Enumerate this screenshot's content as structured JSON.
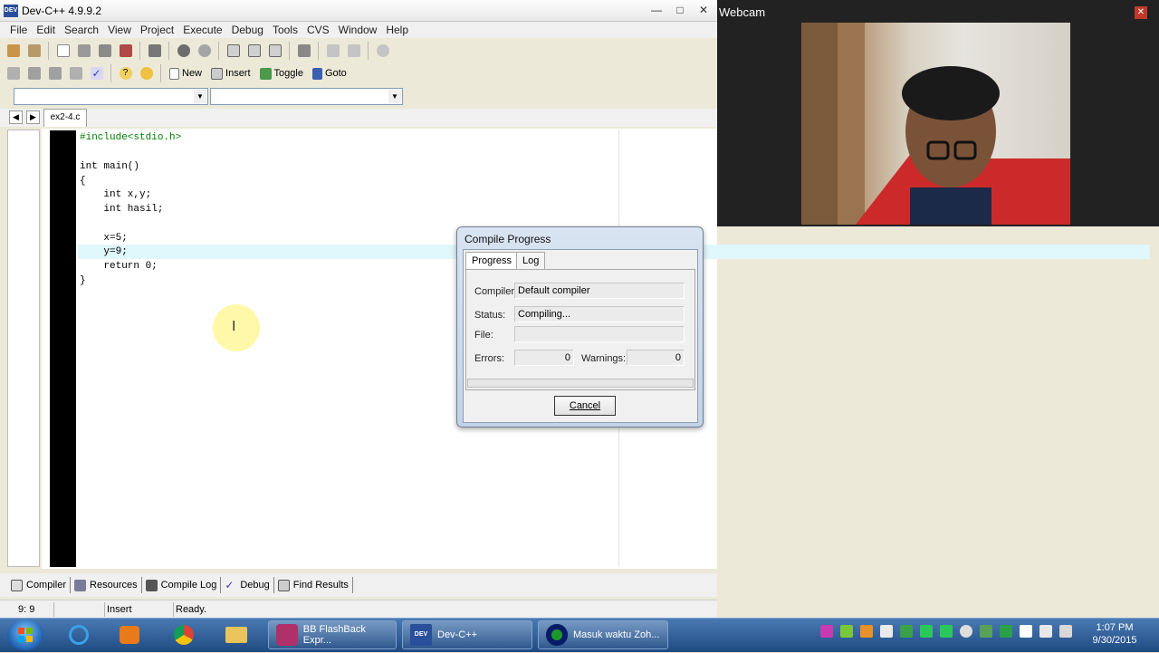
{
  "window": {
    "title": "Dev-C++ 4.9.9.2",
    "minimize": "—",
    "maximize": "□",
    "close": "✕"
  },
  "menu": [
    "File",
    "Edit",
    "Search",
    "View",
    "Project",
    "Execute",
    "Debug",
    "Tools",
    "CVS",
    "Window",
    "Help"
  ],
  "toolbar2": {
    "new_label": "New",
    "insert_label": "Insert",
    "toggle_label": "Toggle",
    "goto_label": "Goto"
  },
  "tabs": {
    "file_tab": "ex2-4.c",
    "prev": "◀",
    "next": "▶"
  },
  "code": [
    "#include<stdio.h>",
    "",
    "int main()",
    "{",
    "    int x,y;",
    "    int hasil;",
    "",
    "    x=5;",
    "    y=9;",
    "    return 0;",
    "}"
  ],
  "bottom_tabs": [
    "Compiler",
    "Resources",
    "Compile Log",
    "Debug",
    "Find Results"
  ],
  "status": {
    "position": "9: 9",
    "mode": "Insert",
    "message": "Ready."
  },
  "webcam": {
    "title": "Webcam",
    "close": "✕"
  },
  "dialog": {
    "title": "Compile Progress",
    "tab_progress": "Progress",
    "tab_log": "Log",
    "compiler_label": "Compiler:",
    "compiler_value": "Default compiler",
    "status_label": "Status:",
    "status_value": "Compiling...",
    "file_label": "File:",
    "file_value": "",
    "errors_label": "Errors:",
    "errors_value": "0",
    "warnings_label": "Warnings:",
    "warnings_value": "0",
    "cancel_label": "Cancel"
  },
  "taskbar": {
    "items": [
      {
        "label": "BB FlashBack Expr..."
      },
      {
        "label": "Dev-C++"
      },
      {
        "label": "Masuk waktu Zoh..."
      }
    ],
    "clock_time": "1:07 PM",
    "clock_date": "9/30/2015"
  },
  "colors": {
    "accent": "#2a4f9a",
    "code_green": "#008000",
    "highlight": "#e0f7fb",
    "taskbar": "#1f4a82"
  }
}
